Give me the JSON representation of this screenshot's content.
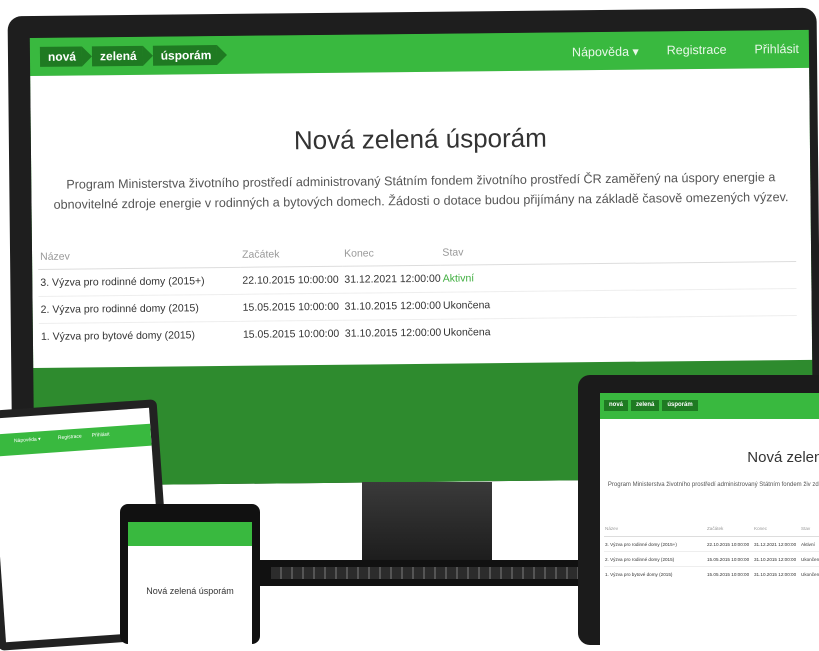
{
  "brand": {
    "logo_parts": [
      "nová",
      "zelená",
      "úsporám"
    ],
    "primary_color": "#39b93f",
    "dark_green": "#1f7a22",
    "active_status_color": "#3fae3f"
  },
  "nav": {
    "help": "Nápověda ▾",
    "register": "Registrace",
    "login": "Přihlásit"
  },
  "page": {
    "title": "Nová zelená úsporám",
    "description": "Program Ministerstva životního prostředí administrovaný Státním fondem životního prostředí ČR zaměřený na úspory energie a obnovitelné zdroje energie v rodinných a bytových domech. Žádosti o dotace budou přijímány na základě časově omezených výzev."
  },
  "table": {
    "headers": [
      "Název",
      "Začátek",
      "Konec",
      "Stav"
    ],
    "rows": [
      {
        "name": "3. Výzva pro rodinné domy (2015+)",
        "start": "22.10.2015 10:00:00",
        "end": "31.12.2021 12:00:00",
        "status": "Aktivní"
      },
      {
        "name": "2. Výzva pro rodinné domy (2015)",
        "start": "15.05.2015 10:00:00",
        "end": "31.10.2015 12:00:00",
        "status": "Ukončena"
      },
      {
        "name": "1. Výzva pro bytové domy (2015)",
        "start": "15.05.2015 10:00:00",
        "end": "31.10.2015 12:00:00",
        "status": "Ukončena"
      }
    ]
  },
  "laptop": {
    "nav_items": [
      "Nápověda ▾",
      "Registrace",
      "Přihlásit"
    ]
  },
  "phone": {
    "title": "Nová zelená úsporám"
  },
  "tablet": {
    "title": "Nová zelená ús",
    "description": "Program Ministerstva životního prostředí administrovaný Státním fondem živ zdroje energie v rodinných a bytových domech. Žádosti o dotace bu"
  }
}
